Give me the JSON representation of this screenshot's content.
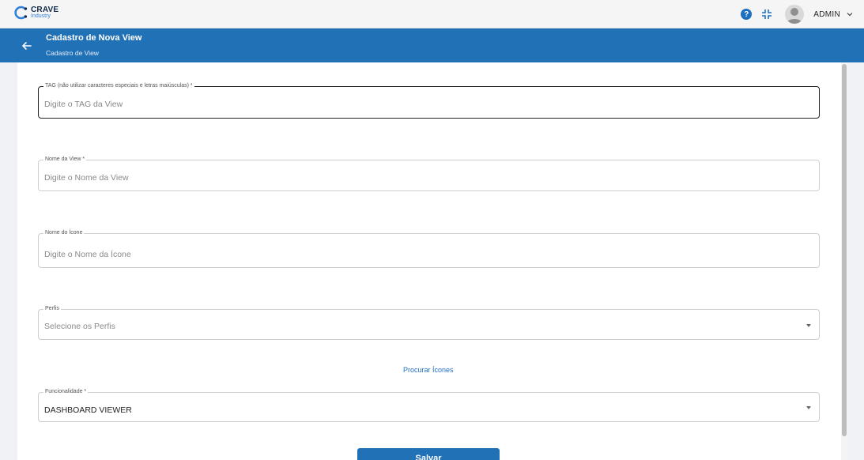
{
  "brand": {
    "name": "CRAVE",
    "sub": "Industry",
    "color": "#0f2a4a",
    "accent": "#2f7ed8"
  },
  "topbar": {
    "help_icon": "help-circle-icon",
    "help_glyph": "?",
    "collapse_icon": "collapse-icon",
    "user_name": "ADMIN",
    "user_chevron_icon": "chevron-down-icon"
  },
  "header": {
    "title": "Cadastro de Nova View",
    "subtitle": "Cadastro de View",
    "back_icon": "arrow-left-icon",
    "background": "#2171b7"
  },
  "form": {
    "tag": {
      "label": "TAG (não utilizar caracteres especiais e letras maiúsculas) *",
      "placeholder": "Digite o TAG da View"
    },
    "view_name": {
      "label": "Nome da View *",
      "placeholder": "Digite o Nome da View"
    },
    "icon_name": {
      "label": "Nome do Ícone",
      "placeholder": "Digite o Nome da Ícone"
    },
    "profiles": {
      "label": "Perfis",
      "placeholder": "Selecione os Perfis"
    },
    "search_icons_link": "Procurar Ícones",
    "functionality": {
      "label": "Funcionalidade *",
      "value": "DASHBOARD VIEWER"
    },
    "save_label": "Salvar"
  }
}
